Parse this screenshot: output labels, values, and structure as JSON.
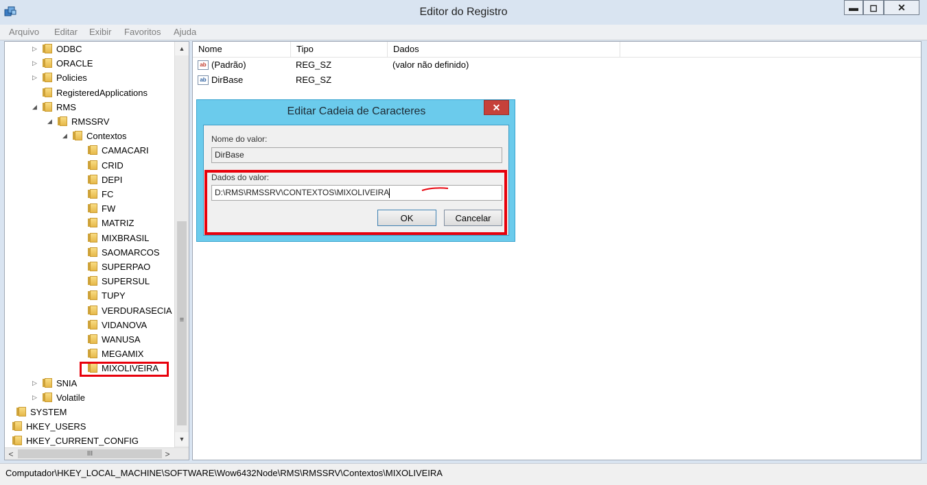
{
  "window": {
    "title": "Editor do Registro",
    "btn_min": "▬",
    "btn_max": "◻",
    "btn_close": "✕"
  },
  "menu": [
    "Arquivo",
    "Editar",
    "Exibir",
    "Favoritos",
    "Ajuda"
  ],
  "tree": [
    {
      "label": "ODBC",
      "expander": "▷"
    },
    {
      "label": "ORACLE",
      "expander": "▷"
    },
    {
      "label": "Policies",
      "expander": "▷"
    },
    {
      "label": "RegisteredApplications",
      "expander": ""
    },
    {
      "label": "RMS",
      "expander": "◢"
    },
    {
      "label": "RMSSRV",
      "expander": "◢"
    },
    {
      "label": "Contextos",
      "expander": "◢"
    },
    {
      "label": "CAMACARI",
      "expander": ""
    },
    {
      "label": "CRID",
      "expander": ""
    },
    {
      "label": "DEPI",
      "expander": ""
    },
    {
      "label": "FC",
      "expander": ""
    },
    {
      "label": "FW",
      "expander": ""
    },
    {
      "label": "MATRIZ",
      "expander": ""
    },
    {
      "label": "MIXBRASIL",
      "expander": ""
    },
    {
      "label": "SAOMARCOS",
      "expander": ""
    },
    {
      "label": "SUPERPAO",
      "expander": ""
    },
    {
      "label": "SUPERSUL",
      "expander": ""
    },
    {
      "label": "TUPY",
      "expander": ""
    },
    {
      "label": "VERDURASECIA",
      "expander": ""
    },
    {
      "label": "VIDANOVA",
      "expander": ""
    },
    {
      "label": "WANUSA",
      "expander": ""
    },
    {
      "label": "MEGAMIX",
      "expander": ""
    },
    {
      "label": "MIXOLIVEIRA",
      "expander": ""
    },
    {
      "label": "SNIA",
      "expander": "▷"
    },
    {
      "label": "Volatile",
      "expander": "▷"
    },
    {
      "label": "SYSTEM",
      "expander": ""
    },
    {
      "label": "HKEY_USERS",
      "expander": ""
    },
    {
      "label": "HKEY_CURRENT_CONFIG",
      "expander": ""
    }
  ],
  "scroll": {
    "up": "▲",
    "down": "▼",
    "grip": "≡",
    "left": "<",
    "right": ">",
    "hgrip": "III"
  },
  "list": {
    "headers": [
      "Nome",
      "Tipo",
      "Dados"
    ],
    "rows": [
      {
        "name": "(Padrão)",
        "type": "REG_SZ",
        "data": "(valor não definido)",
        "icon": "ab"
      },
      {
        "name": "DirBase",
        "type": "REG_SZ",
        "data": "",
        "icon": "ab"
      }
    ]
  },
  "dialog": {
    "title": "Editar Cadeia de Caracteres",
    "close": "✕",
    "name_label": "Nome do valor:",
    "name_value": "DirBase",
    "data_label": "Dados do valor:",
    "data_value": "D:\\RMS\\RMSSRV\\CONTEXTOS\\MIXOLIVEIRA",
    "ok": "OK",
    "cancel": "Cancelar"
  },
  "status": "Computador\\HKEY_LOCAL_MACHINE\\SOFTWARE\\Wow6432Node\\RMS\\RMSSRV\\Contextos\\MIXOLIVEIRA",
  "colors": {
    "highlight": "#e8000b",
    "dialog_frame": "#6bcbec",
    "dialog_close": "#c6413a"
  }
}
